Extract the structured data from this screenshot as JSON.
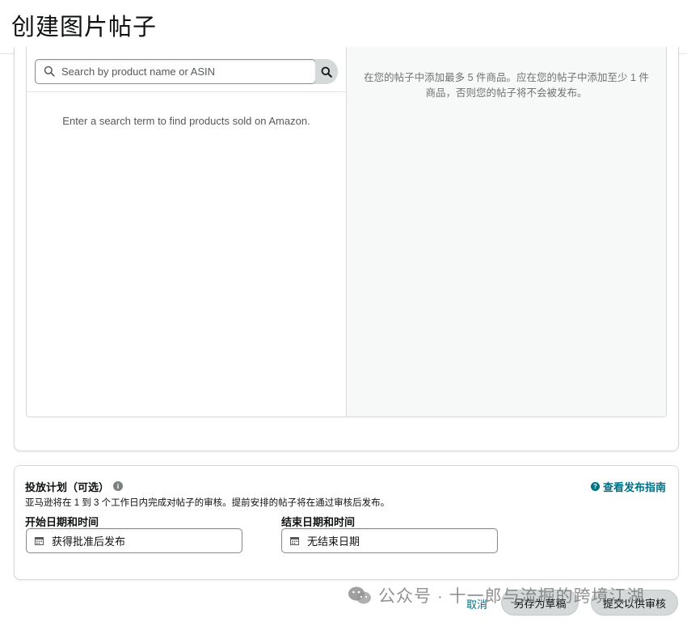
{
  "page": {
    "title": "创建图片帖子"
  },
  "product_picker": {
    "search_placeholder": "Search by product name or ASIN",
    "empty_hint": "Enter a search term to find products sold on Amazon.",
    "limit_note": "在您的帖子中添加最多 5 件商品。应在您的帖子中添加至少 1 件商品，否则您的帖子将不会被发布。"
  },
  "schedule": {
    "title": "投放计划（可选）",
    "description": "亚马逊将在 1 到 3 个工作日内完成对帖子的审核。提前安排的帖子将在通过审核后发布。",
    "guide_link": "查看发布指南",
    "start_label": "开始日期和时间",
    "start_value": "获得批准后发布",
    "end_label": "结束日期和时间",
    "end_value": "无结束日期"
  },
  "footer": {
    "cancel": "取消",
    "save_draft": "另存为草稿",
    "submit": "提交以供审核"
  },
  "watermark": {
    "text": "公众号 · 十一郎与流掘的跨境江湖"
  },
  "colors": {
    "link": "#007185",
    "pill_bg": "#d5d9d9",
    "border": "#d5d9d9",
    "right_pane_bg": "#f7f8f8"
  }
}
